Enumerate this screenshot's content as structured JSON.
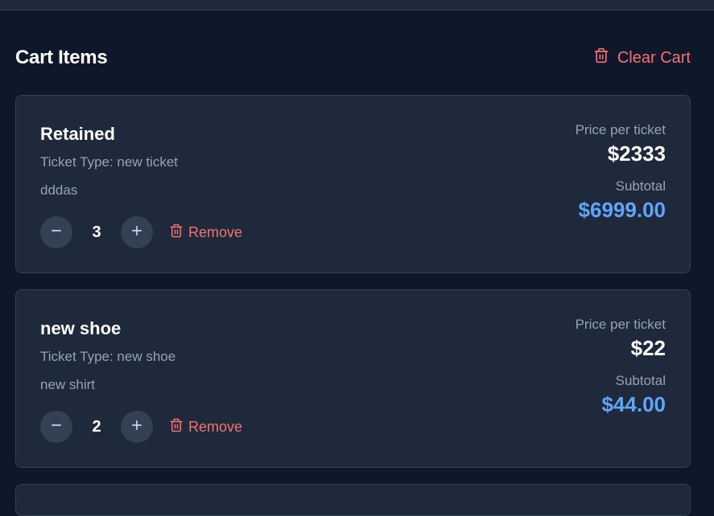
{
  "header": {
    "title": "Cart Items",
    "clear_label": "Clear Cart"
  },
  "labels": {
    "price_label": "Price per ticket",
    "subtotal_label": "Subtotal",
    "remove_label": "Remove",
    "ticket_type_prefix": "Ticket Type: "
  },
  "items": [
    {
      "name": "Retained",
      "ticket_type": "Ticket Type: new ticket",
      "description": "dddas",
      "quantity": "3",
      "price": "$2333",
      "subtotal": "$6999.00"
    },
    {
      "name": "new shoe",
      "ticket_type": "Ticket Type: new shoe",
      "description": "new shirt",
      "quantity": "2",
      "price": "$22",
      "subtotal": "$44.00"
    }
  ],
  "colors": {
    "background": "#0f172a",
    "card": "#1e293b",
    "danger": "#f87171",
    "accent": "#60a5fa"
  },
  "icons": {
    "clear": "trash-icon",
    "minus": "minus-icon",
    "plus": "plus-icon",
    "remove": "trash-icon"
  }
}
